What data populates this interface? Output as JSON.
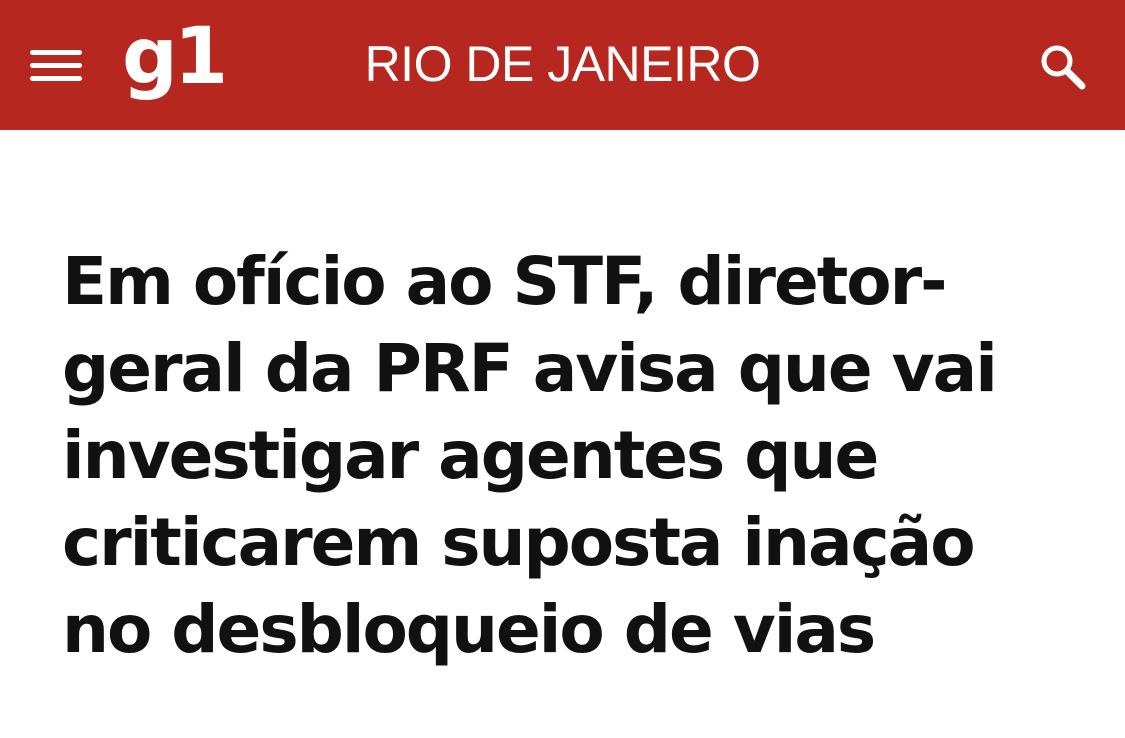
{
  "header": {
    "logo_text": "g1",
    "section_title": "RIO DE JANEIRO",
    "menu_icon": "hamburger-menu-icon",
    "search_icon": "search-icon",
    "background_color": "#b5271f"
  },
  "article": {
    "headline": "Em ofício ao STF, diretor-geral da PRF avisa que vai investigar agentes que criticarem suposta inação no desbloqueio de vias"
  }
}
